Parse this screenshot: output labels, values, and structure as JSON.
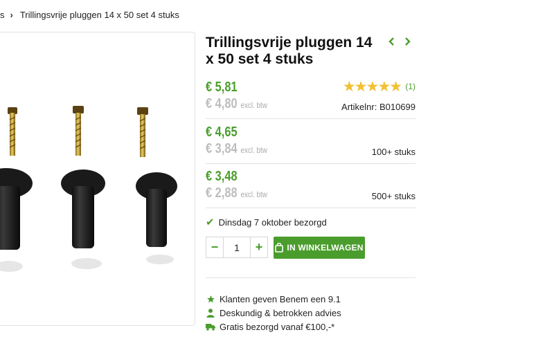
{
  "breadcrumb": {
    "prev": "s",
    "current": "Trillingsvrije pluggen 14 x 50 set 4 stuks"
  },
  "product": {
    "title": "Trillingsvrije pluggen 14 x 50 set 4 stuks",
    "rating_stars": "★★★★★",
    "review_count": "(1)",
    "sku": "Artikelnr: B010699"
  },
  "prices": [
    {
      "incl": "€ 5,81",
      "excl": "€ 4,80",
      "excl_note": "excl. btw",
      "label": ""
    },
    {
      "incl": "€ 4,65",
      "excl": "€ 3,84",
      "excl_note": "excl. btw",
      "label": "100+ stuks"
    },
    {
      "incl": "€ 3,48",
      "excl": "€ 2,88",
      "excl_note": "excl. btw",
      "label": "500+ stuks"
    }
  ],
  "delivery": "Dinsdag 7 oktober bezorgd",
  "quantity": {
    "minus": "−",
    "value": "1",
    "plus": "+"
  },
  "cart_button": "IN WINKELWAGEN",
  "usps": [
    {
      "icon": "star-icon",
      "text": "Klanten geven Benem een 9.1"
    },
    {
      "icon": "person-icon",
      "text": "Deskundig & betrokken advies"
    },
    {
      "icon": "truck-icon",
      "text": "Gratis bezorgd vanaf €100,-*"
    }
  ],
  "colors": {
    "accent": "#4a9d2c",
    "star": "#f2c130",
    "muted": "#bdbdbd"
  }
}
